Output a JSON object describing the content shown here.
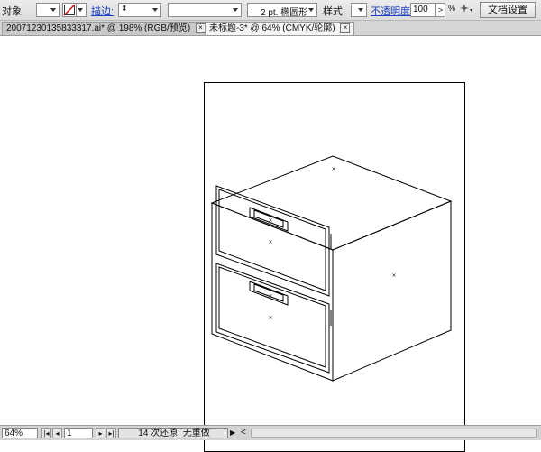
{
  "control_bar": {
    "object_label": "对象",
    "stroke_link": "描边:",
    "stroke_weight_value": "",
    "brush_value": "2 pt. 椭圆形",
    "style_label": "样式:",
    "opacity_link": "不透明度:",
    "opacity_value": "100",
    "opacity_arrow": ">",
    "opacity_unit": "%",
    "doc_setup_button": "文档设置"
  },
  "tabs": [
    {
      "label": "20071230135833317.ai* @ 198% (RGB/预览)",
      "active": false
    },
    {
      "label": "未标题-3* @ 64% (CMYK/轮廓)",
      "active": true
    }
  ],
  "status_bar": {
    "zoom": "64%",
    "page": "1",
    "status_text": "14 次还原: 无重做",
    "play_arrow": "▶",
    "scroll_left": "<"
  },
  "colors": {
    "toolbar_bg": "#dcdcdc",
    "link_blue": "#1a3fc4",
    "no_fill_red": "#cc0000"
  }
}
